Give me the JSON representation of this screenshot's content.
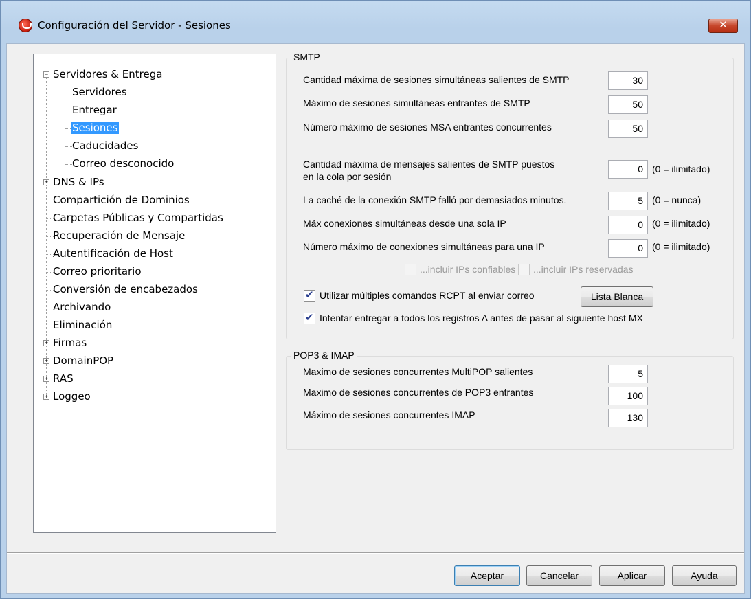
{
  "window": {
    "title": "Configuración del Servidor - Sesiones",
    "close_glyph": "✕"
  },
  "tree": {
    "items": [
      {
        "label": "Servidores & Entrega",
        "expander": "−"
      },
      {
        "label": "Servidores"
      },
      {
        "label": "Entregar"
      },
      {
        "label": "Sesiones"
      },
      {
        "label": "Caducidades"
      },
      {
        "label": "Correo desconocido"
      },
      {
        "label": "DNS & IPs",
        "expander": "+"
      },
      {
        "label": "Compartición de Dominios"
      },
      {
        "label": "Carpetas Públicas y Compartidas"
      },
      {
        "label": "Recuperación de Mensaje"
      },
      {
        "label": "Autentificación de Host"
      },
      {
        "label": "Correo prioritario"
      },
      {
        "label": "Conversión de encabezados"
      },
      {
        "label": "Archivando"
      },
      {
        "label": "Eliminación"
      },
      {
        "label": "Firmas",
        "expander": "+"
      },
      {
        "label": "DomainPOP",
        "expander": "+"
      },
      {
        "label": "RAS",
        "expander": "+"
      },
      {
        "label": "Loggeo",
        "expander": "+"
      }
    ]
  },
  "smtp": {
    "title": "SMTP",
    "max_outbound_label": "Cantidad máxima de sesiones simultáneas salientes de SMTP",
    "max_outbound_value": "30",
    "max_inbound_label": "Máximo de sesiones simultáneas entrantes de SMTP",
    "max_inbound_value": "50",
    "max_msa_label": "Número máximo de sesiones MSA entrantes concurrentes",
    "max_msa_value": "50",
    "max_msgs_label_1": "Cantidad máxima de mensajes salientes de SMTP puestos",
    "max_msgs_label_2": "en la cola por sesión",
    "max_msgs_value": "0",
    "max_msgs_note": "(0 = ilimitado)",
    "cache_label": "La caché de la conexión SMTP falló por demasiados minutos.",
    "cache_value": "5",
    "cache_note": "(0 = nunca)",
    "max_single_ip_label": "Máx conexiones simultáneas desde una sola IP",
    "max_single_ip_value": "0",
    "max_single_ip_note": "(0 = ilimitado)",
    "max_per_ip_label": "Número máximo de conexiones simultáneas para una IP",
    "max_per_ip_value": "0",
    "max_per_ip_note": "(0 = ilimitado)",
    "include_trusted_label": "...incluir IPs confiables",
    "include_reserved_label": "...incluir IPs reservadas",
    "multiple_rcpt_label": "Utilizar múltiples comandos RCPT al enviar correo",
    "whitelist_button": "Lista Blanca",
    "try_all_a_label": "Intentar entregar a todos los registros A antes de pasar al siguiente host MX"
  },
  "pop3": {
    "title": "POP3 & IMAP",
    "multipop_label": "Maximo de sesiones concurrentes MultiPOP salientes",
    "multipop_value": "5",
    "pop3_in_label": "Maximo de sesiones concurrentes de POP3 entrantes",
    "pop3_in_value": "100",
    "imap_label": "Máximo de sesiones concurrentes IMAP",
    "imap_value": "130"
  },
  "buttons": {
    "ok": "Aceptar",
    "cancel": "Cancelar",
    "apply": "Aplicar",
    "help": "Ayuda"
  }
}
